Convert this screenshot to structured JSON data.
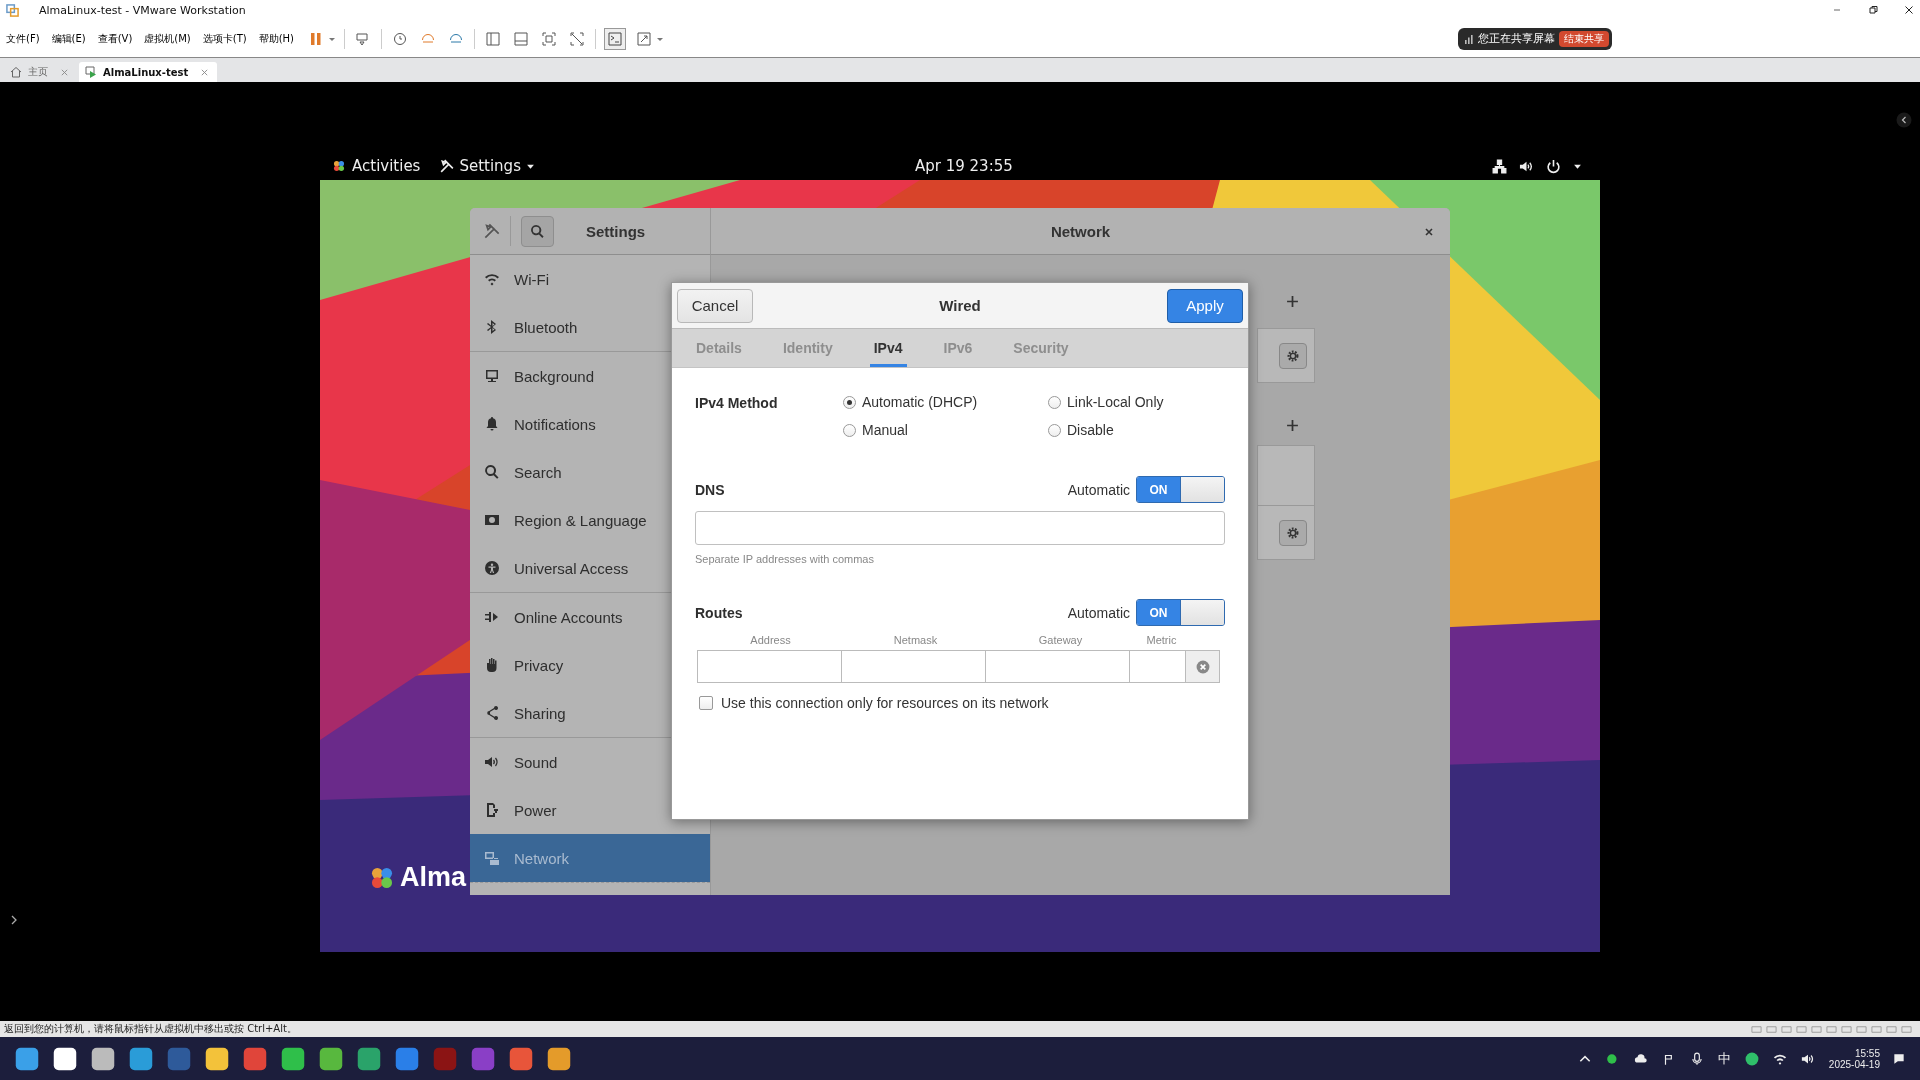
{
  "window": {
    "title": "AlmaLinux-test - VMware Workstation"
  },
  "menu": [
    "文件(F)",
    "编辑(E)",
    "查看(V)",
    "虚拟机(M)",
    "选项卡(T)",
    "帮助(H)"
  ],
  "share_banner": {
    "text": "您正在共享屏幕",
    "button": "结束共享"
  },
  "tabs": [
    {
      "label": "主页",
      "selected": false
    },
    {
      "label": "AlmaLinux-test",
      "selected": true
    }
  ],
  "gnome_bar": {
    "activities": "Activities",
    "app_menu": "Settings",
    "clock": "Apr 19  23:55"
  },
  "desktop": {
    "logo_text": "Alma"
  },
  "settings": {
    "title": "Settings",
    "panel_title": "Network",
    "sidebar": [
      [
        {
          "label": "Wi-Fi",
          "selected": false
        },
        {
          "label": "Bluetooth",
          "selected": false
        }
      ],
      [
        {
          "label": "Background",
          "selected": false
        },
        {
          "label": "Notifications",
          "selected": false
        },
        {
          "label": "Search",
          "selected": false
        },
        {
          "label": "Region & Language",
          "selected": false
        },
        {
          "label": "Universal Access",
          "selected": false
        }
      ],
      [
        {
          "label": "Online Accounts",
          "selected": false
        },
        {
          "label": "Privacy",
          "selected": false
        },
        {
          "label": "Sharing",
          "selected": false
        }
      ],
      [
        {
          "label": "Sound",
          "selected": false
        },
        {
          "label": "Power",
          "selected": false
        },
        {
          "label": "Network",
          "selected": true
        }
      ]
    ]
  },
  "dialog": {
    "cancel": "Cancel",
    "title": "Wired",
    "apply": "Apply",
    "tabs": [
      {
        "label": "Details",
        "selected": false
      },
      {
        "label": "Identity",
        "selected": false
      },
      {
        "label": "IPv4",
        "selected": true
      },
      {
        "label": "IPv6",
        "selected": false
      },
      {
        "label": "Security",
        "selected": false
      }
    ],
    "method_label": "IPv4 Method",
    "methods": [
      {
        "label": "Automatic (DHCP)",
        "selected": true
      },
      {
        "label": "Link-Local Only",
        "selected": false
      },
      {
        "label": "Manual",
        "selected": false
      },
      {
        "label": "Disable",
        "selected": false
      }
    ],
    "dns": {
      "label": "DNS",
      "toggle": {
        "label": "Automatic",
        "on": true,
        "text": "ON"
      },
      "hint": "Separate IP addresses with commas"
    },
    "routes": {
      "label": "Routes",
      "toggle": {
        "label": "Automatic",
        "on": true,
        "text": "ON"
      },
      "columns": [
        "Address",
        "Netmask",
        "Gateway",
        "Metric"
      ]
    },
    "restrict": {
      "label": "Use this connection only for resources on its network",
      "checked": false
    }
  },
  "status_bar": "返回到您的计算机，请将鼠标指针从虚拟机中移出或按 Ctrl+Alt。",
  "taskbar": {
    "ime": "中",
    "time": "15:55",
    "date": "2025-04-19"
  }
}
